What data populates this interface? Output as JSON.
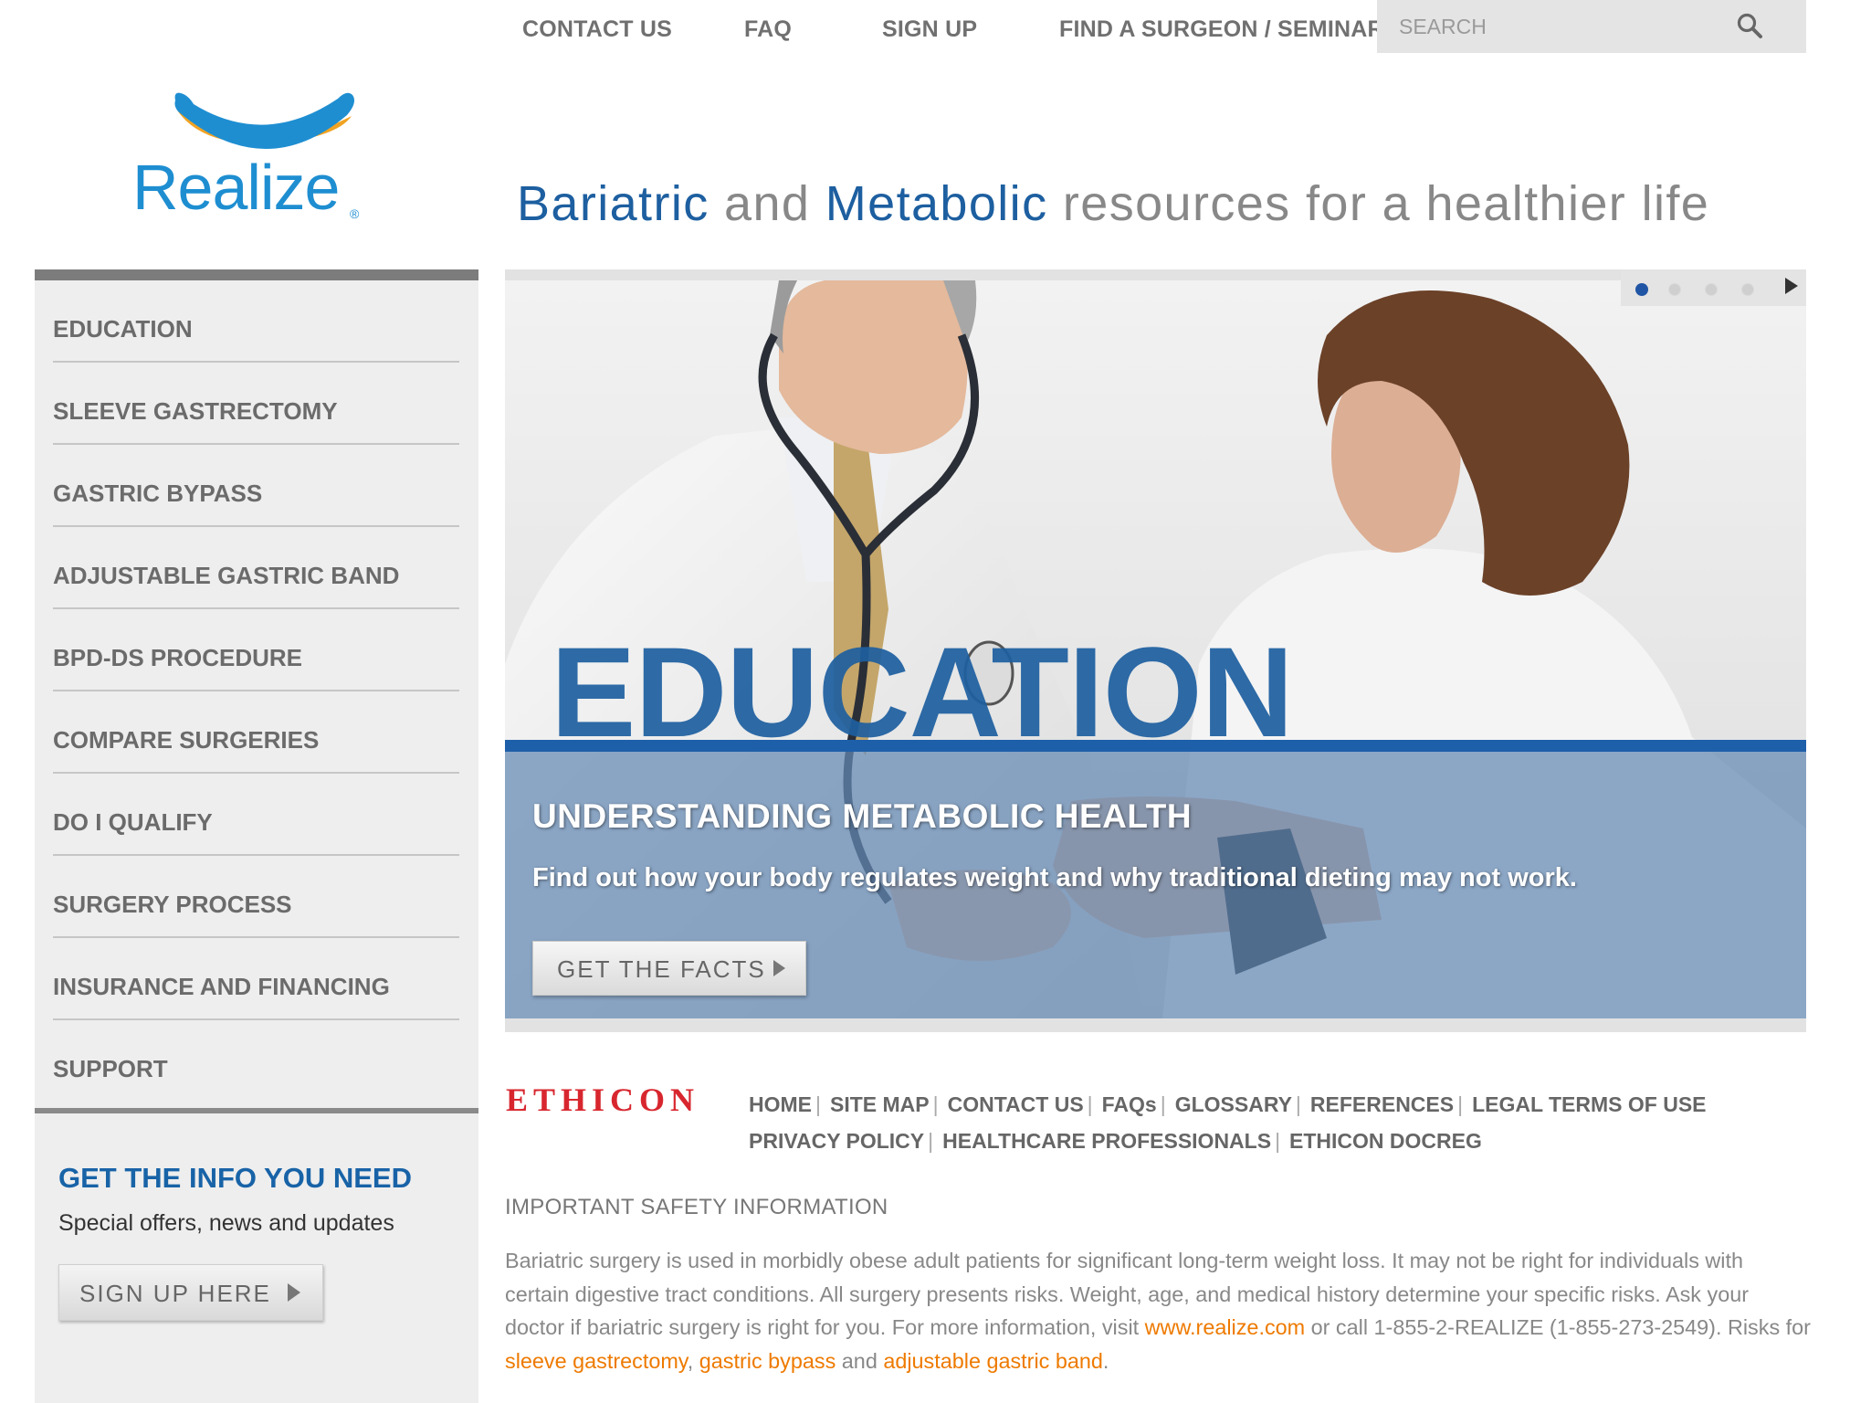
{
  "topnav": {
    "contact": "CONTACT US",
    "faq": "FAQ",
    "signup": "SIGN UP",
    "find": "FIND A SURGEON / SEMINAR",
    "search_placeholder": "SEARCH"
  },
  "logo": {
    "text": "Realize",
    "reg": "®"
  },
  "tagline": {
    "p1": "Bariatric",
    "p2": " and ",
    "p3": "Metabolic",
    "p4": " resources for a healthier life"
  },
  "sidebar": {
    "items": [
      {
        "label": "EDUCATION"
      },
      {
        "label": "SLEEVE GASTRECTOMY"
      },
      {
        "label": "GASTRIC BYPASS"
      },
      {
        "label": "ADJUSTABLE GASTRIC BAND"
      },
      {
        "label": "BPD-DS PROCEDURE"
      },
      {
        "label": "COMPARE SURGERIES"
      },
      {
        "label": "DO I QUALIFY"
      },
      {
        "label": "SURGERY PROCESS"
      },
      {
        "label": "INSURANCE AND FINANCING"
      },
      {
        "label": "SUPPORT"
      }
    ],
    "promo_title": "GET THE INFO YOU NEED",
    "promo_sub": "Special offers, news and updates",
    "promo_button": "SIGN UP HERE"
  },
  "hero": {
    "word": "EDUCATION",
    "title": "UNDERSTANDING METABOLIC HEALTH",
    "subtitle": "Find out how your body regulates weight and why traditional dieting may not work.",
    "button": "GET THE FACTS",
    "slide_count": 4,
    "active_slide": 1
  },
  "footer": {
    "brand": "ETHICON",
    "row1": [
      "HOME",
      "SITE MAP",
      "CONTACT US",
      "FAQs",
      "GLOSSARY",
      "REFERENCES",
      "LEGAL TERMS OF USE"
    ],
    "row2": [
      "PRIVACY POLICY",
      "HEALTHCARE PROFESSIONALS",
      "ETHICON DOCREG"
    ]
  },
  "safety": {
    "heading": "IMPORTANT SAFETY INFORMATION",
    "text1": "Bariatric surgery is used in morbidly obese adult patients for significant long-term weight loss. It may not be right for individuals with certain digestive tract conditions. All surgery presents risks. Weight, age, and medical history determine your specific risks. Ask your doctor if bariatric surgery is right for you. For more information, visit ",
    "link_site": "www.realize.com",
    "text2": " or call 1-855-2-REALIZE (1-855-273-2549). Risks for ",
    "link_sleeve": "sleeve gastrectomy",
    "comma": ", ",
    "link_bypass": "gastric bypass",
    "and": " and ",
    "link_band": "adjustable gastric band",
    "period": "."
  },
  "colors": {
    "brand_blue": "#1d5fa0",
    "logo_blue": "#1e8ed1",
    "logo_orange": "#f0a323",
    "link_orange": "#ee7a00",
    "ethicon_red": "#d8262e"
  }
}
